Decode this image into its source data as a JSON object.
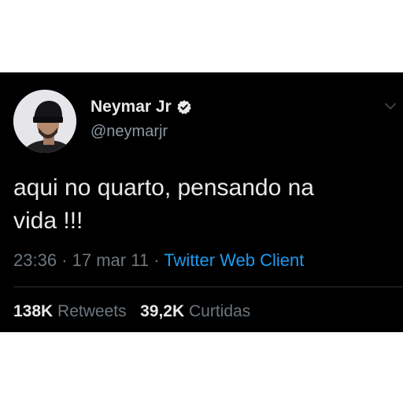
{
  "tweet": {
    "author": {
      "display_name": "Neymar Jr",
      "handle": "@neymarjr",
      "verified": true
    },
    "text_line1": "aqui no quarto, pensando na",
    "text_line2": "vida !!!",
    "time": "23:36",
    "separator": "·",
    "date": "17 mar 11",
    "source": "Twitter Web Client",
    "retweets_count": "138K",
    "retweets_label": "Retweets",
    "likes_count": "39,2K",
    "likes_label": "Curtidas"
  },
  "colors": {
    "background": "#000000",
    "text": "#e8e8e8",
    "muted": "#6e767d",
    "link": "#1d9bf0"
  },
  "icons": {
    "verified": "verified-badge-icon",
    "menu": "chevron-down-icon"
  }
}
